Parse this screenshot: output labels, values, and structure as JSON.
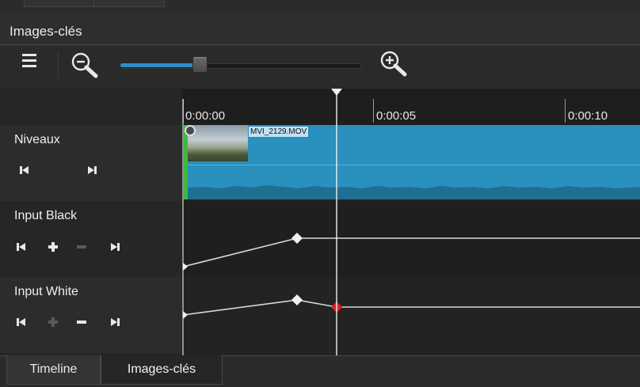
{
  "header": {
    "title": "Images-clés"
  },
  "toolbar": {
    "menu_icon": "hamburger-menu-icon",
    "zoom_out_icon": "zoom-out-icon",
    "zoom_in_icon": "zoom-in-icon",
    "zoom_level_fraction": 0.32
  },
  "ruler": {
    "ticks": [
      "0:00:00",
      "0:00:05",
      "0:00:10"
    ]
  },
  "tracks": [
    {
      "name": "Niveaux",
      "buttons": [
        "previous-keyframe-icon",
        "next-keyframe-icon"
      ]
    },
    {
      "name": "Input Black",
      "buttons": [
        "previous-keyframe-icon",
        "add-keyframe-icon",
        "remove-keyframe-icon",
        "next-keyframe-icon"
      ]
    },
    {
      "name": "Input White",
      "buttons": [
        "previous-keyframe-icon",
        "add-keyframe-icon",
        "remove-keyframe-icon",
        "next-keyframe-icon"
      ]
    }
  ],
  "clip": {
    "name": "MVI_2129.MOV"
  },
  "colors": {
    "accent": "#2f8cc7",
    "clip": "#2a90bd",
    "selected_keyframe": "#e02020",
    "playhead": "#f0f0f0"
  },
  "tabs": [
    {
      "label": "Timeline"
    },
    {
      "label": "Images-clés"
    }
  ]
}
